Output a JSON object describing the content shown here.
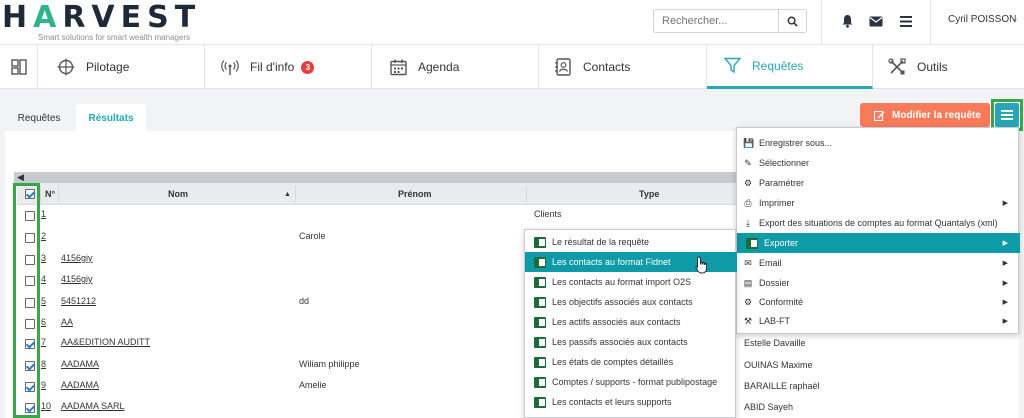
{
  "brand": {
    "logo_prefix": "H",
    "logo_accent": "A",
    "logo_suffix": "RVEST",
    "tagline": "Smart solutions for smart wealth managers"
  },
  "topbar": {
    "search_placeholder": "Rechercher...",
    "user_name": "Cyril POISSON"
  },
  "nav": [
    {
      "label": "",
      "icon": "dashboard-icon"
    },
    {
      "label": "Pilotage",
      "icon": "crosshair-icon"
    },
    {
      "label": "Fil d'info",
      "icon": "antenna-icon",
      "badge": "3"
    },
    {
      "label": "Agenda",
      "icon": "calendar-icon"
    },
    {
      "label": "Contacts",
      "icon": "contacts-icon"
    },
    {
      "label": "Requêtes",
      "icon": "filter-icon",
      "active": true
    },
    {
      "label": "Outils",
      "icon": "tools-icon"
    }
  ],
  "subtabs": {
    "requetes": "Requêtes",
    "resultats": "Résultats"
  },
  "buttons": {
    "modify": "Modifier la requête"
  },
  "table": {
    "columns": {
      "num": "N°",
      "nom": "Nom",
      "prenom": "Prénom",
      "type": "Type"
    },
    "rows": [
      {
        "checked": false,
        "num": "1",
        "nom": "",
        "prenom": "",
        "type": "Clients"
      },
      {
        "checked": false,
        "num": "2",
        "nom": "",
        "prenom": "Carole",
        "type": ""
      },
      {
        "checked": false,
        "num": "3",
        "nom": "4156giy",
        "prenom": "",
        "type": ""
      },
      {
        "checked": false,
        "num": "4",
        "nom": "4156giy",
        "prenom": "",
        "type": ""
      },
      {
        "checked": false,
        "num": "5",
        "nom": "5451212",
        "prenom": "dd",
        "type": ""
      },
      {
        "checked": false,
        "num": "6",
        "nom": "AA",
        "prenom": "",
        "type": ""
      },
      {
        "checked": true,
        "num": "7",
        "nom": "AA&EDITION AUDITT",
        "prenom": "",
        "type": ""
      },
      {
        "checked": true,
        "num": "8",
        "nom": "AADAMA",
        "prenom": "Wiliam philippe",
        "type": ""
      },
      {
        "checked": true,
        "num": "9",
        "nom": "AADAMA",
        "prenom": "Amelie",
        "type": ""
      },
      {
        "checked": true,
        "num": "10",
        "nom": "AADAMA SARL",
        "prenom": "",
        "type": ""
      }
    ],
    "side_names": [
      "Estelle Davaille",
      "OUINAS Maxime",
      "BARAILLE raphaël",
      "ABID Sayeh"
    ]
  },
  "menu": [
    {
      "label": "Enregistrer sous...",
      "icon": "save-icon"
    },
    {
      "label": "Sélectionner",
      "icon": "edit-icon"
    },
    {
      "label": "Paramétrer",
      "icon": "gear-icon"
    },
    {
      "label": "Imprimer",
      "icon": "print-icon",
      "submenu": true
    },
    {
      "label": "Export des situations de comptes au format Quantalys (xml)",
      "icon": "download-icon"
    },
    {
      "label": "Exporter",
      "icon": "excel-icon",
      "submenu": true,
      "highlight": true
    },
    {
      "label": "Email",
      "icon": "email-icon",
      "submenu": true
    },
    {
      "label": "Dossier",
      "icon": "id-card-icon",
      "submenu": true
    },
    {
      "label": "Conformité",
      "icon": "gear-icon",
      "submenu": true
    },
    {
      "label": "LAB-FT",
      "icon": "gavel-icon",
      "submenu": true
    }
  ],
  "submenu": [
    {
      "label": "Le résultat de la requête"
    },
    {
      "label": "Les contacts au format Fidnet",
      "highlight": true
    },
    {
      "label": "Les contacts au format import O2S"
    },
    {
      "label": "Les objectifs associés aux contacts"
    },
    {
      "label": "Les actifs associés aux contacts"
    },
    {
      "label": "Les passifs associés aux contacts"
    },
    {
      "label": "Les états de comptes détaillés"
    },
    {
      "label": "Comptes / supports - format publipostage"
    },
    {
      "label": "Les contacts et leurs supports"
    }
  ],
  "colors": {
    "accent": "#27a7b5",
    "highlight": "#0f9aa7",
    "modify_button": "#f77b5a",
    "annotation_green": "#3aa64a",
    "badge": "#e2403c"
  }
}
